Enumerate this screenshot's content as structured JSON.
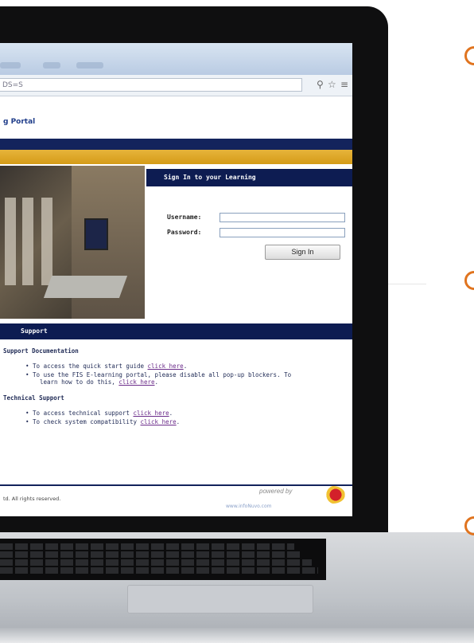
{
  "browser": {
    "url_fragment": "DS=S",
    "pin_icon": "pin-icon",
    "star_icon": "star-icon",
    "menu_icon": "menu-icon"
  },
  "portal": {
    "title": "g Portal"
  },
  "signin": {
    "header": "Sign In to your Learning",
    "username_label": "Username:",
    "password_label": "Password:",
    "username_value": "",
    "password_value": "",
    "button": "Sign In"
  },
  "support": {
    "header": "Support",
    "documentation_heading": "Support Documentation",
    "doc_item1_text": "To access the quick start guide ",
    "doc_item1_link": "click here",
    "doc_item2_text": "To use the FIS E-learning portal, please disable all pop-up blockers. To",
    "doc_item2_cont": "learn how to do this, ",
    "doc_item2_link": "click here",
    "technical_heading": "Technical Support",
    "tech_item1_text": "To access technical support ",
    "tech_item1_link": "click here",
    "tech_item2_text": "To check system compatibility ",
    "tech_item2_link": "click here"
  },
  "footer": {
    "copyright": "td. All rights reserved.",
    "powered_by": "powered by",
    "powered_url": "www.infoNuvo.com"
  },
  "colors": {
    "navy": "#0d1c52",
    "gold": "#e0a62a",
    "link": "#6b2c8a",
    "accent_orange": "#e0741f"
  }
}
